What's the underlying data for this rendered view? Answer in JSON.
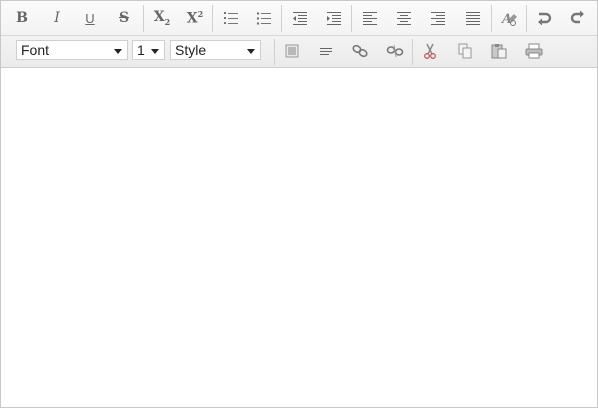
{
  "toolbar": {
    "bold_label": "B",
    "italic_label": "I",
    "underline_label": "U",
    "strike_label": "S",
    "subscript_label": "X",
    "subscript_mark": "2",
    "superscript_label": "X",
    "superscript_mark": "2",
    "font_select": {
      "value": "Font"
    },
    "size_select": {
      "value": "1"
    },
    "style_select": {
      "value": "Style"
    }
  },
  "content": {
    "text": ""
  }
}
